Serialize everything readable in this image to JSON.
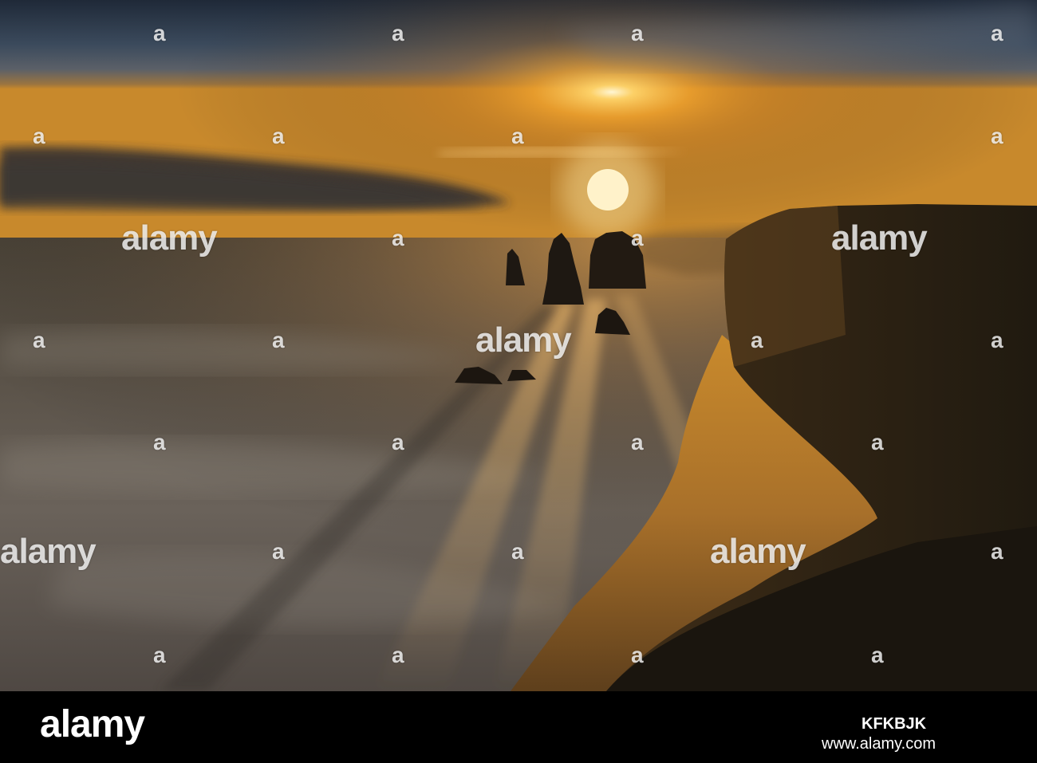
{
  "watermark": {
    "word": "alamy",
    "letter": "a"
  },
  "footer": {
    "logo": "alamy",
    "image_id": "KFKBJK",
    "url": "www.alamy.com"
  }
}
